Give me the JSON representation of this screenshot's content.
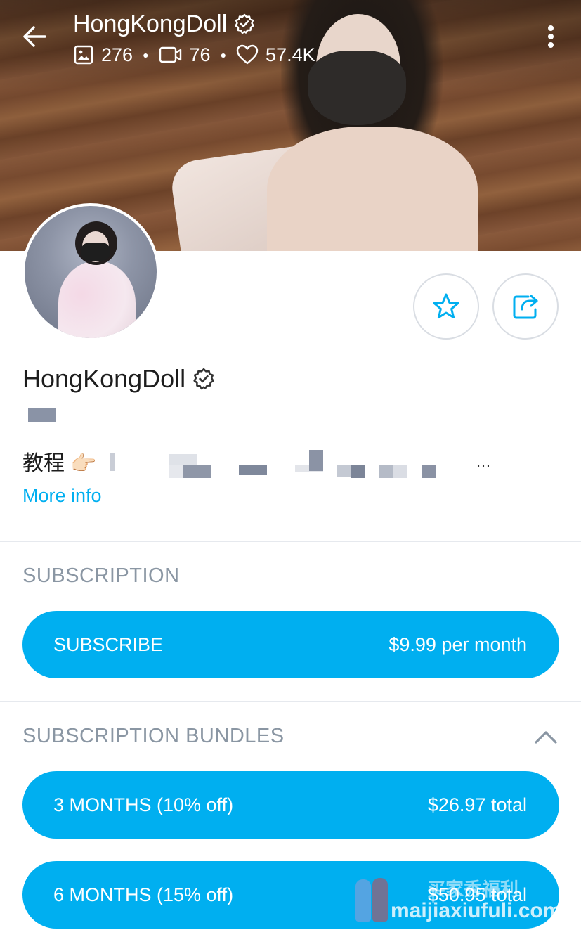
{
  "header": {
    "title": "HongKongDoll",
    "stats": {
      "photos": "276",
      "videos": "76",
      "likes": "57.4K"
    }
  },
  "profile": {
    "name": "HongKongDoll",
    "bio_visible_text": "教程 👉🏻",
    "bio_ellipsis": "…",
    "more_info": "More info"
  },
  "subscription": {
    "label": "SUBSCRIPTION",
    "button_label": "SUBSCRIBE",
    "price": "$9.99 per month"
  },
  "bundles": {
    "label": "SUBSCRIPTION BUNDLES",
    "items": [
      {
        "label": "3 MONTHS (10% off)",
        "price": "$26.97 total"
      },
      {
        "label": "6 MONTHS (15% off)",
        "price": "$50.95 total"
      }
    ]
  },
  "watermark": {
    "top": "买家秀福利",
    "bottom": "maijiaxiufuli.com"
  },
  "colors": {
    "accent": "#00aff0",
    "section_label": "#8a96a3",
    "text": "#1d1d1d"
  },
  "icons": [
    "back-arrow-icon",
    "verified-badge-icon",
    "image-icon",
    "video-icon",
    "heart-icon",
    "more-vertical-icon",
    "star-icon",
    "share-icon",
    "chevron-up-icon"
  ]
}
